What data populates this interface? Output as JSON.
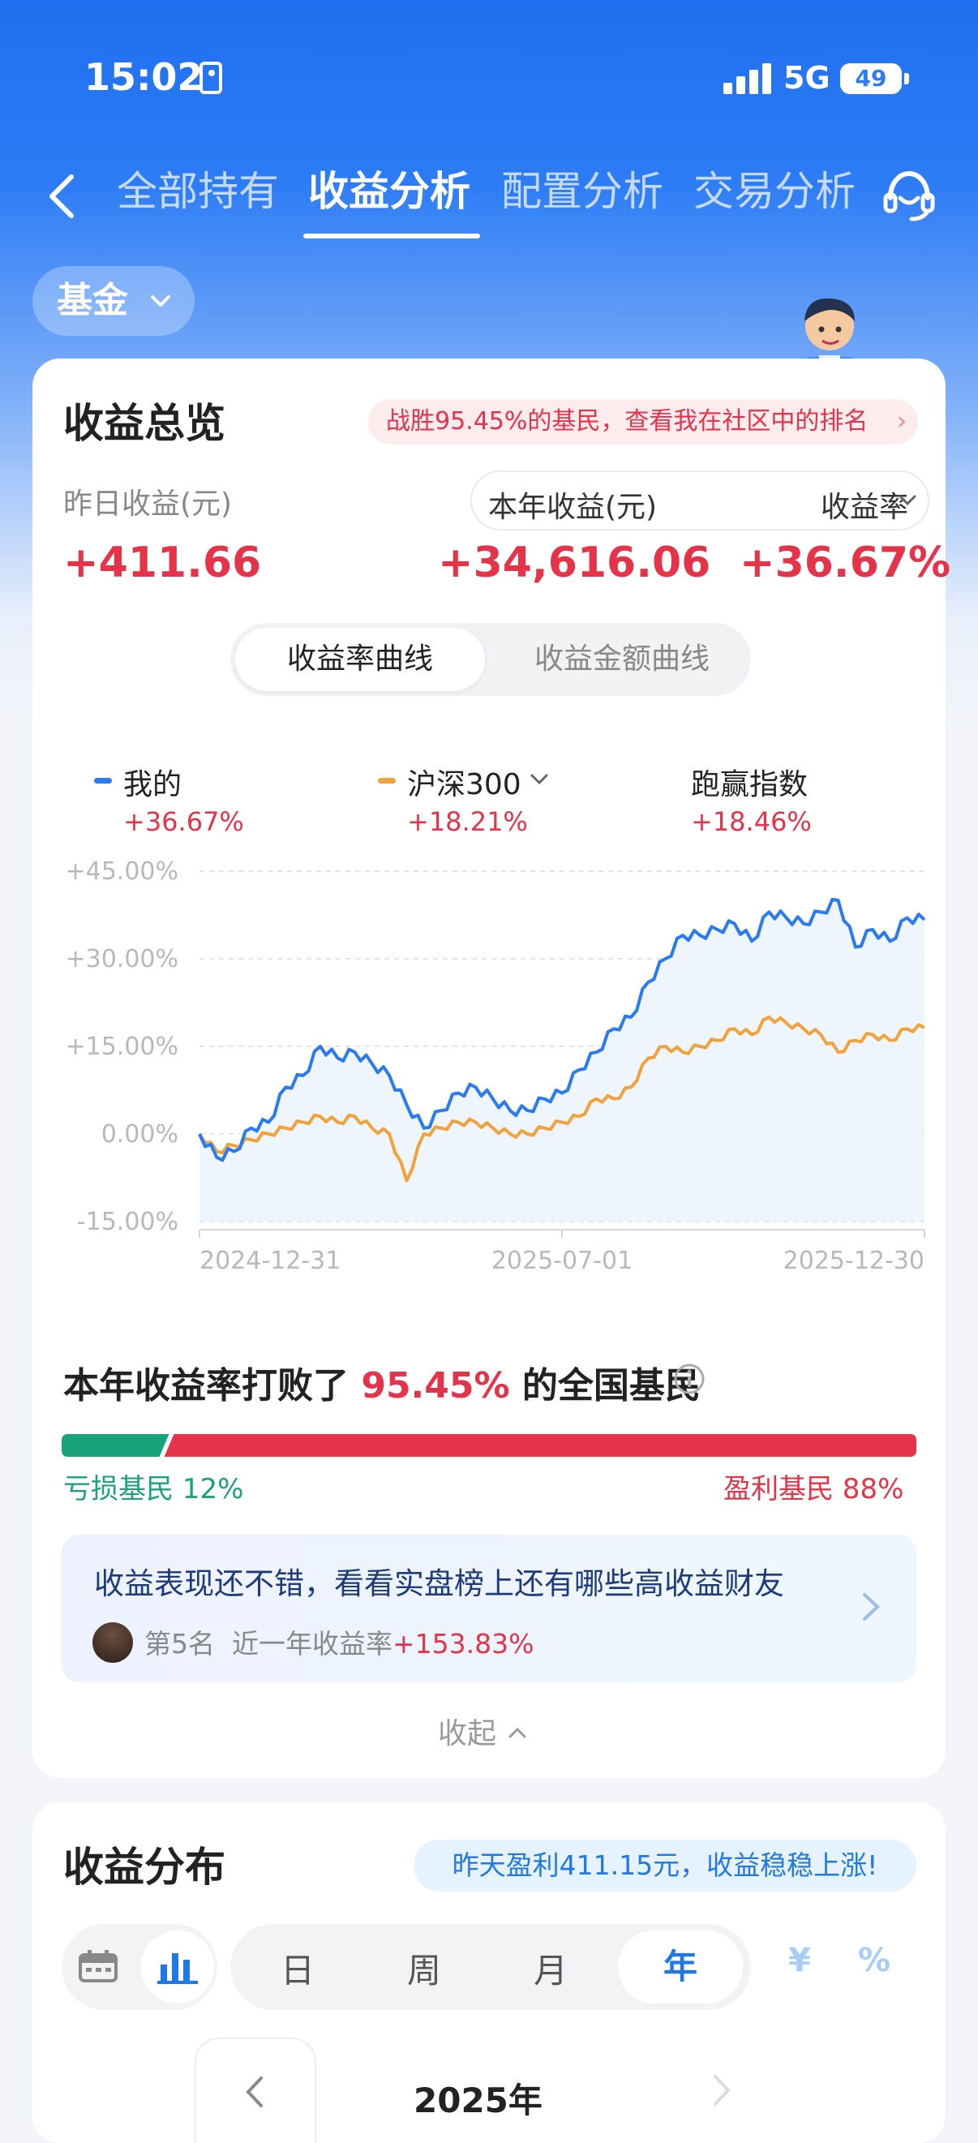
{
  "status_bar": {
    "time": "15:02",
    "network": "5G",
    "battery": "49"
  },
  "nav": {
    "tabs": [
      "全部持有",
      "收益分析",
      "配置分析",
      "交易分析"
    ],
    "active_tab": 1
  },
  "filter": {
    "label": "基金"
  },
  "overview": {
    "title": "收益总览",
    "rank_banner": "战胜95.45%的基民，查看我在社区中的排名",
    "yesterday_label": "昨日收益(元)",
    "yesterday_value": "+411.66",
    "year_label": "本年收益(元)",
    "rate_label": "收益率",
    "year_value": "+34,616.06",
    "rate_value": "+36.67%",
    "curve_tabs": [
      "收益率曲线",
      "收益金额曲线"
    ]
  },
  "legend": [
    {
      "name": "我的",
      "value": "+36.67%",
      "color": "#2a7af2"
    },
    {
      "name": "沪深300",
      "value": "+18.21%",
      "color": "#f2a23a"
    },
    {
      "name": "跑赢指数",
      "value": "+18.46%"
    }
  ],
  "chart_data": {
    "type": "line",
    "y_ticks": [
      "+45.00%",
      "+30.00%",
      "+15.00%",
      "0.00%",
      "-15.00%"
    ],
    "ylim": [
      -15,
      45
    ],
    "x_ticks": [
      "2024-12-31",
      "2025-07-01",
      "2025-12-30"
    ],
    "grid": true,
    "series": [
      {
        "name": "我的",
        "color": "#2a7af2",
        "values": [
          0,
          -4,
          -3,
          1,
          2,
          8,
          10,
          15,
          13,
          14,
          12,
          10,
          5,
          1,
          4,
          7,
          8,
          6,
          4,
          4,
          6,
          7,
          11,
          14,
          18,
          20,
          26,
          30,
          34,
          34,
          35,
          36,
          33,
          38,
          37,
          36,
          38,
          40,
          32,
          35,
          33,
          37,
          36.67
        ]
      },
      {
        "name": "沪深300",
        "color": "#f2a23a",
        "values": [
          0,
          -3,
          -2,
          -1,
          0,
          1,
          2,
          3,
          2,
          3,
          1,
          0,
          -8,
          0,
          1,
          2,
          2,
          1,
          0,
          0,
          1,
          2,
          3,
          6,
          6,
          8,
          13,
          15,
          14,
          15,
          16,
          18,
          17,
          20,
          19,
          18,
          17,
          14,
          16,
          17,
          16,
          18,
          18.21
        ]
      }
    ]
  },
  "beat": {
    "prefix": "本年收益率打败了",
    "pct": "95.45%",
    "suffix": "的全国基民"
  },
  "split": {
    "loss_label": "亏损基民 12%",
    "gain_label": "盈利基民 88%",
    "loss_pct": 12
  },
  "promo": {
    "title": "收益表现还不错，看看实盘榜上还有哪些高收益财友",
    "rank": "第5名",
    "sub": "近一年收益率",
    "rate": "+153.83%"
  },
  "collapse_label": "收起",
  "distribution": {
    "title": "收益分布",
    "banner": "昨天盈利411.15元，收益稳稳上涨!",
    "periods": [
      "日",
      "周",
      "月",
      "年"
    ],
    "active_period": "年",
    "units": [
      "¥",
      "%"
    ],
    "year": "2025年"
  }
}
